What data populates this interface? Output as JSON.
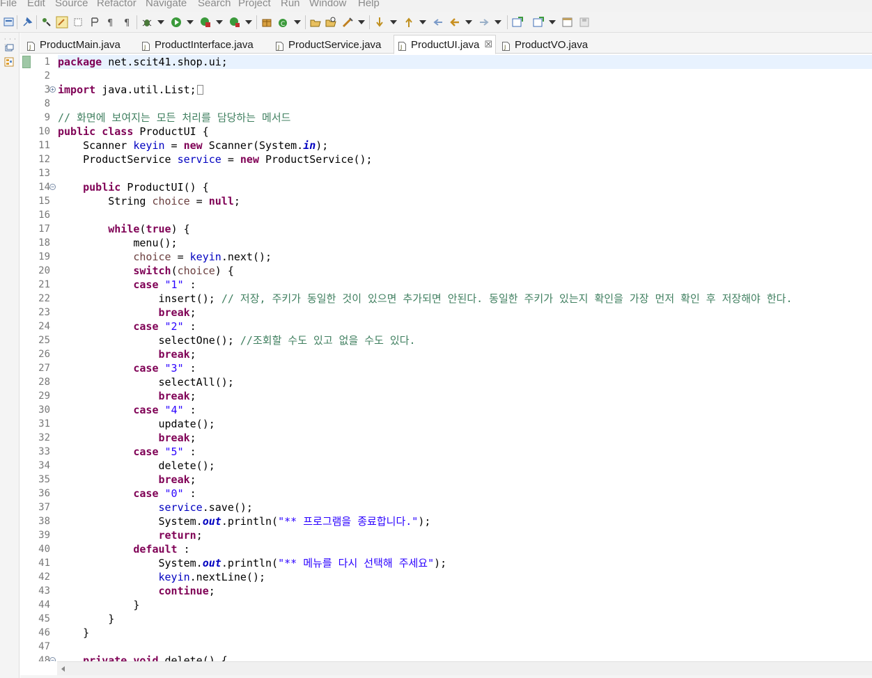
{
  "menu": [
    {
      "label": "File"
    },
    {
      "label": "Edit"
    },
    {
      "label": "Source"
    },
    {
      "label": "Refactor"
    },
    {
      "label": "Navigate"
    },
    {
      "label": "Search"
    },
    {
      "label": "Project"
    },
    {
      "label": "Run"
    },
    {
      "label": "Window"
    },
    {
      "label": "Help"
    }
  ],
  "toolbar": {
    "icons": [
      "new-wizard-icon",
      "pin-icon",
      "open-type-icon",
      "toggle-mark-occurrences-icon",
      "toggle-block-selection-icon",
      "show-whitespace-icon",
      "paragraph-icon",
      "debug-icon",
      "run-icon",
      "coverage-icon",
      "external-tools-icon",
      "new-java-package-icon",
      "new-java-class-icon",
      "open-task-icon",
      "search-icon",
      "annotation-next-icon",
      "annotation-previous-icon",
      "last-edit-location-icon",
      "back-icon",
      "forward-icon",
      "new-folder-icon",
      "new-file-icon",
      "save-icon",
      "save-all-icon"
    ]
  },
  "tabs": [
    {
      "label": "ProductMain.java",
      "active": false
    },
    {
      "label": "ProductInterface.java",
      "active": false
    },
    {
      "label": "ProductService.java",
      "active": false
    },
    {
      "label": "ProductUI.java",
      "active": true,
      "close": "☒"
    },
    {
      "label": "ProductVO.java",
      "active": false
    }
  ],
  "editor": {
    "file": "ProductUI.java",
    "current_line": 1,
    "lines": [
      {
        "n": "1",
        "code": "package net.scit41.shop.ui;"
      },
      {
        "n": "2",
        "code": ""
      },
      {
        "n": "3",
        "code": "import java.util.List;",
        "fold": "+"
      },
      {
        "n": "8",
        "code": ""
      },
      {
        "n": "9",
        "code": "// 화면에 보여지는 모든 처리를 담당하는 메서드"
      },
      {
        "n": "10",
        "code": "public class ProductUI {"
      },
      {
        "n": "11",
        "code": "    Scanner keyin = new Scanner(System.in);"
      },
      {
        "n": "12",
        "code": "    ProductService service = new ProductService();"
      },
      {
        "n": "13",
        "code": ""
      },
      {
        "n": "14",
        "code": "    public ProductUI() {",
        "fold": "−"
      },
      {
        "n": "15",
        "code": "        String choice = null;"
      },
      {
        "n": "16",
        "code": ""
      },
      {
        "n": "17",
        "code": "        while(true) {"
      },
      {
        "n": "18",
        "code": "            menu();"
      },
      {
        "n": "19",
        "code": "            choice = keyin.next();"
      },
      {
        "n": "20",
        "code": "            switch(choice) {"
      },
      {
        "n": "21",
        "code": "            case \"1\" :"
      },
      {
        "n": "22",
        "code": "                insert(); // 저장, 주키가 동일한 것이 있으면 추가되면 안된다. 동일한 주키가 있는지 확인을 가장 먼저 확인 후 저장해야 한다."
      },
      {
        "n": "23",
        "code": "                break;"
      },
      {
        "n": "24",
        "code": "            case \"2\" :"
      },
      {
        "n": "25",
        "code": "                selectOne(); //조회할 수도 있고 없을 수도 있다."
      },
      {
        "n": "26",
        "code": "                break;"
      },
      {
        "n": "27",
        "code": "            case \"3\" :"
      },
      {
        "n": "28",
        "code": "                selectAll();"
      },
      {
        "n": "29",
        "code": "                break;"
      },
      {
        "n": "30",
        "code": "            case \"4\" :"
      },
      {
        "n": "31",
        "code": "                update();"
      },
      {
        "n": "32",
        "code": "                break;"
      },
      {
        "n": "33",
        "code": "            case \"5\" :"
      },
      {
        "n": "34",
        "code": "                delete();"
      },
      {
        "n": "35",
        "code": "                break;"
      },
      {
        "n": "36",
        "code": "            case \"0\" :"
      },
      {
        "n": "37",
        "code": "                service.save();"
      },
      {
        "n": "38",
        "code": "                System.out.println(\"** 프로그램을 종료합니다.\");"
      },
      {
        "n": "39",
        "code": "                return;"
      },
      {
        "n": "40",
        "code": "            default :"
      },
      {
        "n": "41",
        "code": "                System.out.println(\"** 메뉴를 다시 선택해 주세요\");"
      },
      {
        "n": "42",
        "code": "                keyin.nextLine();"
      },
      {
        "n": "43",
        "code": "                continue;"
      },
      {
        "n": "44",
        "code": "            }"
      },
      {
        "n": "45",
        "code": "        }"
      },
      {
        "n": "46",
        "code": "    }"
      },
      {
        "n": "47",
        "code": ""
      },
      {
        "n": "48",
        "code": "    private void delete() {",
        "fold": "−"
      }
    ]
  },
  "colors": {
    "keyword": "#7f0055",
    "field": "#0000c0",
    "string": "#2a00ff",
    "comment": "#3f7f5f",
    "local_variable": "#6a3e3e",
    "current_line_bg": "#e8f2fe"
  }
}
